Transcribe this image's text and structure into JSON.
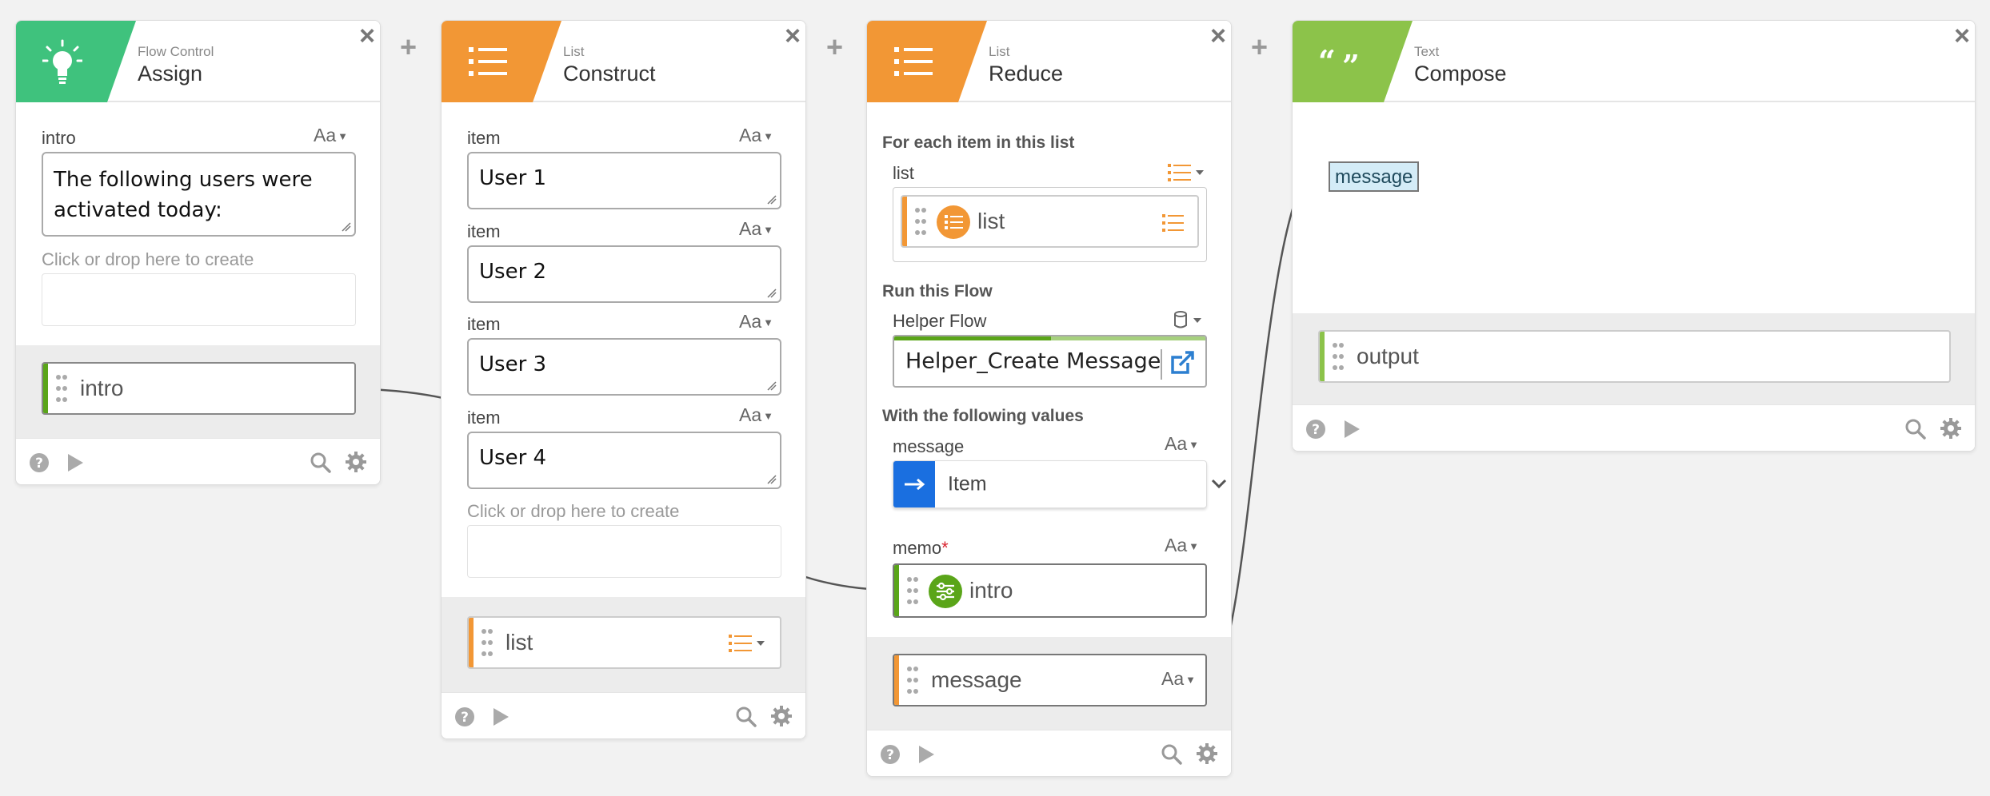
{
  "colors": {
    "flow_control": "#3fc27d",
    "list": "#f29735",
    "text": "#8cc34a",
    "item_blue": "#1a6fe0",
    "variable_green": "#5aa519"
  },
  "cards": {
    "assign": {
      "category": "Flow Control",
      "title": "Assign",
      "icon": "lightbulb-icon",
      "field_label": "intro",
      "type_label": "Aa",
      "field_value": "The following users were activated today:",
      "drop_hint": "Click or drop here to create",
      "output": "intro"
    },
    "construct": {
      "category": "List",
      "title": "Construct",
      "icon": "list-icon",
      "items": [
        {
          "label": "item",
          "type": "Aa",
          "value": "User 1"
        },
        {
          "label": "item",
          "type": "Aa",
          "value": "User 2"
        },
        {
          "label": "item",
          "type": "Aa",
          "value": "User 3"
        },
        {
          "label": "item",
          "type": "Aa",
          "value": "User 4"
        }
      ],
      "drop_hint": "Click or drop here to create",
      "output": "list"
    },
    "reduce": {
      "category": "List",
      "title": "Reduce",
      "icon": "list-icon",
      "section_each": "For each item in this list",
      "list_label": "list",
      "list_value": "list",
      "section_run": "Run this Flow",
      "helper_label": "Helper Flow",
      "helper_value": "Helper_Create Message",
      "section_values": "With the following values",
      "message_label": "message",
      "message_type": "Aa",
      "message_value": "Item",
      "memo_label": "memo",
      "memo_required": "*",
      "memo_type": "Aa",
      "memo_value": "intro",
      "output": "message",
      "output_type": "Aa"
    },
    "compose": {
      "category": "Text",
      "title": "Compose",
      "icon": "quote-icon",
      "token": "message",
      "output": "output"
    }
  },
  "connector_plus": "+"
}
